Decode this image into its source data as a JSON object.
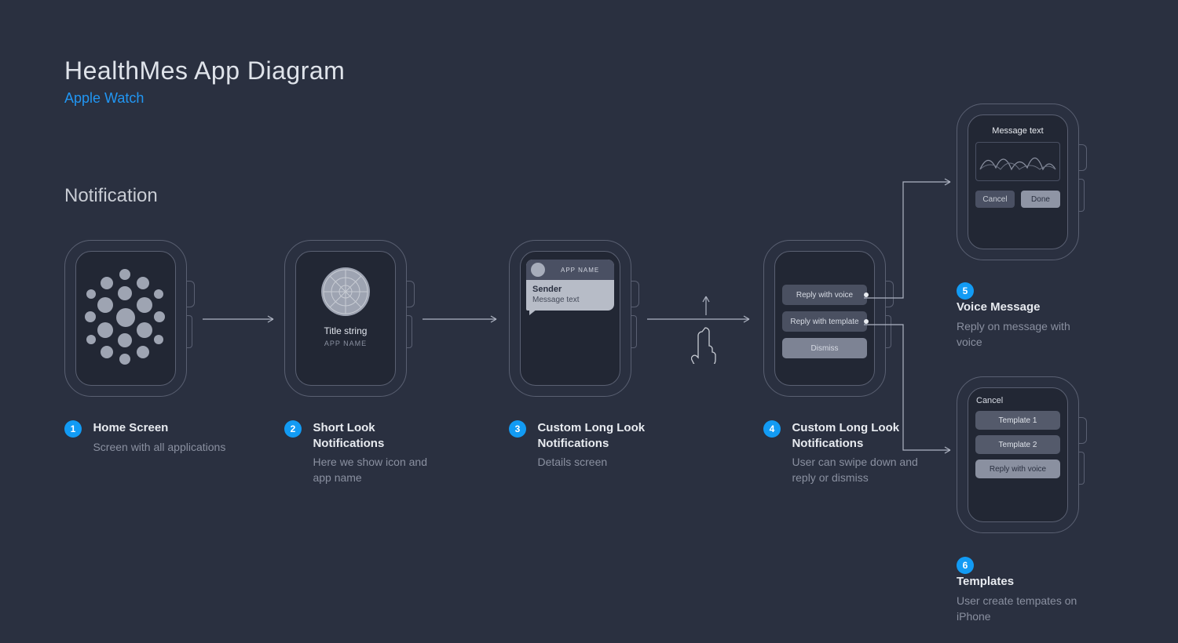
{
  "header": {
    "title": "HealthMes  App Diagram",
    "subtitle": "Apple Watch"
  },
  "section": "Notification",
  "steps": {
    "s1": {
      "num": "1",
      "title": "Home Screen",
      "desc": "Screen with all applications"
    },
    "s2": {
      "num": "2",
      "title": "Short Look Notifications",
      "desc": "Here we show icon and app name",
      "screen": {
        "title_string": "Title string",
        "app_name": "APP NAME"
      }
    },
    "s3": {
      "num": "3",
      "title": "Custom Long Look Notifications",
      "desc": "Details screen",
      "screen": {
        "app_name": "APP NAME",
        "sender": "Sender",
        "message": "Message text"
      }
    },
    "s4": {
      "num": "4",
      "title": "Custom Long Look Notifications",
      "desc": "User can swipe down and reply or dismiss",
      "screen": {
        "reply_voice": "Reply with voice",
        "reply_template": "Reply with template",
        "dismiss": "Dismiss"
      }
    },
    "s5": {
      "num": "5",
      "title": "Voice Message",
      "desc": "Reply on message with voice",
      "screen": {
        "message": "Message text",
        "cancel": "Cancel",
        "done": "Done"
      }
    },
    "s6": {
      "num": "6",
      "title": "Templates",
      "desc": "User create tempates on iPhone",
      "screen": {
        "cancel": "Cancel",
        "t1": "Template 1",
        "t2": "Template 2",
        "reply_voice": "Reply with voice"
      }
    }
  },
  "colors": {
    "accent": "#129bf4",
    "bg": "#2a3040"
  }
}
